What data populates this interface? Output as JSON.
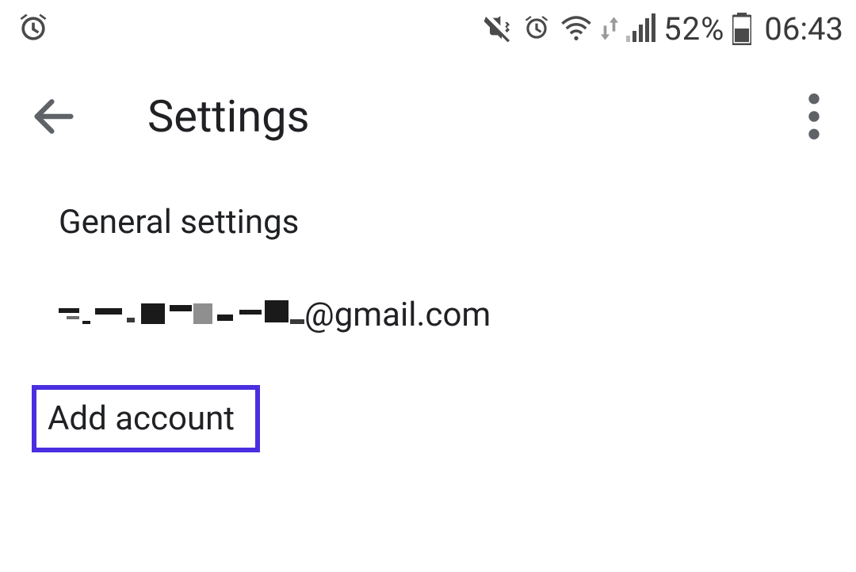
{
  "status": {
    "battery_text": "52%",
    "time": "06:43"
  },
  "header": {
    "title": "Settings"
  },
  "rows": {
    "general": "General settings",
    "account_suffix": "@gmail.com",
    "add_account": "Add account"
  },
  "colors": {
    "highlight": "#4a2fe0"
  }
}
